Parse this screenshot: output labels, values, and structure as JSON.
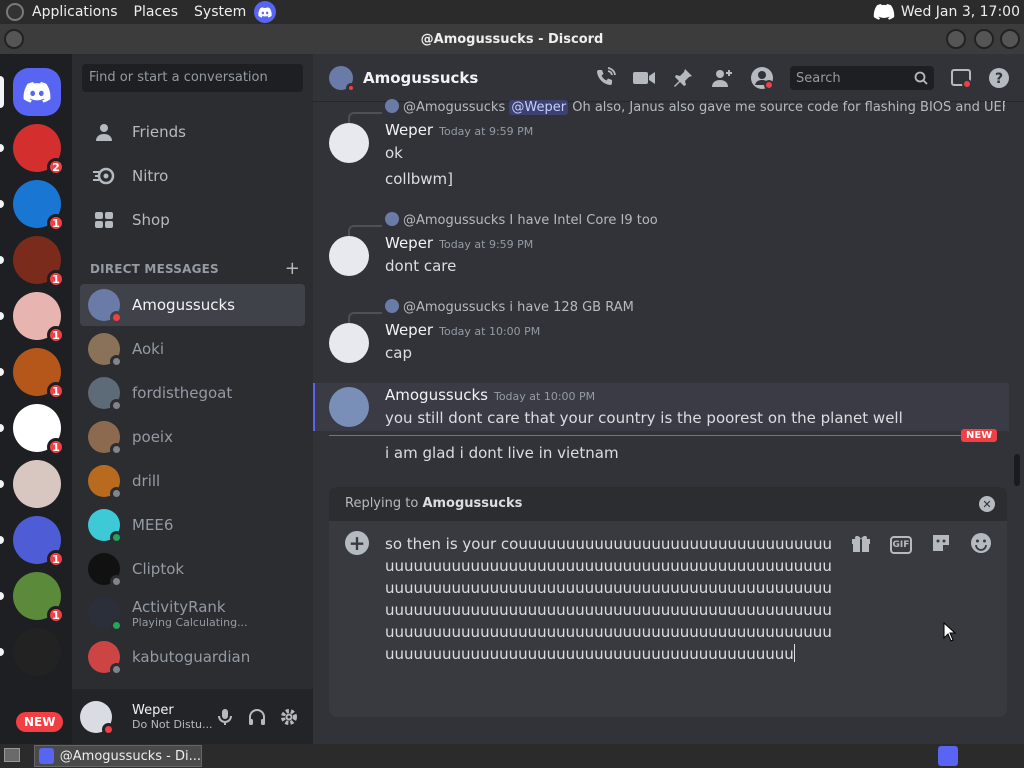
{
  "system_panel": {
    "menus": [
      "Applications",
      "Places",
      "System"
    ],
    "clock": "Wed Jan  3, 17:00"
  },
  "window": {
    "title": "@Amogussucks - Discord"
  },
  "servers": [
    {
      "badge": "2",
      "color": "#d32f2f"
    },
    {
      "badge": "1",
      "color": "#1976d2"
    },
    {
      "badge": "1",
      "color": "#7a2b1b"
    },
    {
      "badge": "1",
      "color": "#e8b4b0"
    },
    {
      "badge": "1",
      "color": "#b5561b"
    },
    {
      "badge": "1",
      "color": "#ffffff"
    },
    {
      "badge": "",
      "color": "#d8c6c0"
    },
    {
      "badge": "1",
      "color": "#4e5cd6"
    },
    {
      "badge": "1",
      "color": "#5a8a3a"
    },
    {
      "badge": "",
      "color": "#222222"
    }
  ],
  "new_pill": "NEW",
  "sidebar": {
    "search_placeholder": "Find or start a conversation",
    "nav": [
      "Friends",
      "Nitro",
      "Shop"
    ],
    "dm_header": "DIRECT MESSAGES",
    "dms": [
      {
        "name": "Amogussucks",
        "sub": "",
        "status": "dnd",
        "color": "#6b7ba8",
        "active": true
      },
      {
        "name": "Aoki",
        "sub": "",
        "status": "off",
        "color": "#8a7258"
      },
      {
        "name": "fordisthegoat",
        "sub": "",
        "status": "off",
        "color": "#5d6a78"
      },
      {
        "name": "poeix",
        "sub": "",
        "status": "off",
        "color": "#8c6a4f"
      },
      {
        "name": "drill",
        "sub": "",
        "status": "off",
        "color": "#b86b1f"
      },
      {
        "name": "MEE6",
        "sub": "",
        "status": "on",
        "color": "#3dc9d6"
      },
      {
        "name": "Cliptok",
        "sub": "",
        "status": "off",
        "color": "#111111"
      },
      {
        "name": "ActivityRank",
        "sub": "Playing Calculating...",
        "status": "on",
        "color": "#2a2f3a"
      },
      {
        "name": "kabutoguardian",
        "sub": "",
        "status": "off",
        "color": "#c44"
      }
    ]
  },
  "user_panel": {
    "name": "Weper",
    "status": "Do Not Distu..."
  },
  "chat": {
    "title": "Amogussucks",
    "search": "Search",
    "messages": [
      {
        "reply_author": "@Amogussucks",
        "reply_mention": "@Weper",
        "reply_text": "Oh also, Janus also gave me source code for flashing BIOS and UEF",
        "author": "Weper",
        "time": "Today at 9:59 PM",
        "lines": [
          "ok",
          "collbwm]"
        ]
      },
      {
        "reply_author": "@Amogussucks",
        "reply_text": "I have Intel Core I9 too",
        "author": "Weper",
        "time": "Today at 9:59 PM",
        "lines": [
          "dont care"
        ]
      },
      {
        "reply_author": "@Amogussucks",
        "reply_text": "i have 128 GB RAM",
        "author": "Weper",
        "time": "Today at 10:00 PM",
        "lines": [
          "cap"
        ]
      },
      {
        "author": "Amogussucks",
        "time": "Today at 10:00 PM",
        "lines": [
          "you still dont care that your country is the poorest on the planet well"
        ]
      },
      {
        "lines": [
          "i am glad i dont live in vietnam"
        ]
      }
    ],
    "new_tag": "NEW",
    "replying_prefix": "Replying to ",
    "replying_to": "Amogussucks",
    "composer_text": "so then is your couuuuuuuuuuuuuuuuuuuuuuuuuuuuuuuuuuuuuuuuuuuuuuuuuuuuuuuuuuuuuuuuuuuuuuuuuuuuuuuuuuuuuuuuuuuuuuuuuuuuuuuuuuuuuuuuuuuuuuuuuuuuuuuuuuuuuuuuuuuuuuuuuuuuuuuuuuuuuuuuuuuuuuuuuuuuuuuuuuuuuuuuuuuuuuuuuuuuuuuuuuuuuuuuuuuuuuuuuuuuuuuuuuuuuuuuuuuuuuuuuuuuuuuuuuuuuuuuuuuuuuuu"
  },
  "taskbar": {
    "task_label": "@Amogussucks - Di..."
  }
}
